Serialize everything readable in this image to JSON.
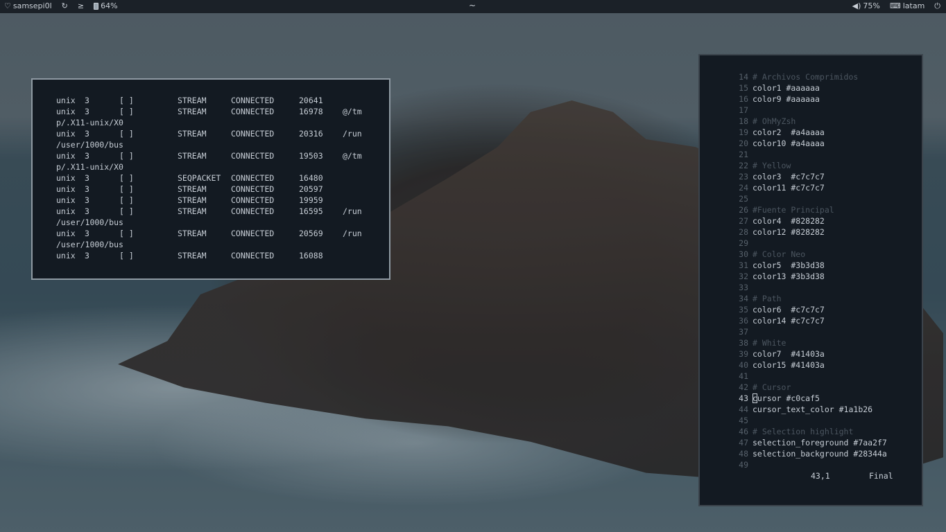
{
  "topbar": {
    "user": "samsepi0l",
    "battery": "64%",
    "center": "~",
    "volume": "75%",
    "keyboard": "latam",
    "icons": {
      "user": "heart-icon",
      "updates": "refresh-icon",
      "terminal": "terminal-prompt-icon",
      "battery": "battery-icon",
      "volume": "speaker-icon",
      "keyboard": "keyboard-icon",
      "power": "power-icon"
    }
  },
  "netstat": {
    "rows": [
      {
        "proto": "unix",
        "refcnt": "3",
        "flags": "[ ]",
        "type": "STREAM",
        "state": "CONNECTED",
        "inode": "20641",
        "path": ""
      },
      {
        "proto": "unix",
        "refcnt": "3",
        "flags": "[ ]",
        "type": "STREAM",
        "state": "CONNECTED",
        "inode": "16978",
        "path": "@/tm"
      },
      {
        "wrap": "p/.X11-unix/X0"
      },
      {
        "proto": "unix",
        "refcnt": "3",
        "flags": "[ ]",
        "type": "STREAM",
        "state": "CONNECTED",
        "inode": "20316",
        "path": "/run"
      },
      {
        "wrap": "/user/1000/bus"
      },
      {
        "proto": "unix",
        "refcnt": "3",
        "flags": "[ ]",
        "type": "STREAM",
        "state": "CONNECTED",
        "inode": "19503",
        "path": "@/tm"
      },
      {
        "wrap": "p/.X11-unix/X0"
      },
      {
        "proto": "unix",
        "refcnt": "3",
        "flags": "[ ]",
        "type": "SEQPACKET",
        "state": "CONNECTED",
        "inode": "16480",
        "path": ""
      },
      {
        "proto": "unix",
        "refcnt": "3",
        "flags": "[ ]",
        "type": "STREAM",
        "state": "CONNECTED",
        "inode": "20597",
        "path": ""
      },
      {
        "proto": "unix",
        "refcnt": "3",
        "flags": "[ ]",
        "type": "STREAM",
        "state": "CONNECTED",
        "inode": "19959",
        "path": ""
      },
      {
        "proto": "unix",
        "refcnt": "3",
        "flags": "[ ]",
        "type": "STREAM",
        "state": "CONNECTED",
        "inode": "16595",
        "path": "/run"
      },
      {
        "wrap": "/user/1000/bus"
      },
      {
        "proto": "unix",
        "refcnt": "3",
        "flags": "[ ]",
        "type": "STREAM",
        "state": "CONNECTED",
        "inode": "20569",
        "path": "/run"
      },
      {
        "wrap": "/user/1000/bus"
      },
      {
        "proto": "unix",
        "refcnt": "3",
        "flags": "[ ]",
        "type": "STREAM",
        "state": "CONNECTED",
        "inode": "16088",
        "path": ""
      }
    ]
  },
  "editor": {
    "lines": [
      {
        "n": "14",
        "text": "# Archivos Comprimidos",
        "comment": true
      },
      {
        "n": "15",
        "text": "color1 #aaaaaa"
      },
      {
        "n": "16",
        "text": "color9 #aaaaaa"
      },
      {
        "n": "17",
        "text": ""
      },
      {
        "n": "18",
        "text": "# OhMyZsh",
        "comment": true
      },
      {
        "n": "19",
        "text": "color2  #a4aaaa"
      },
      {
        "n": "20",
        "text": "color10 #a4aaaa"
      },
      {
        "n": "21",
        "text": ""
      },
      {
        "n": "22",
        "text": "# Yellow",
        "comment": true
      },
      {
        "n": "23",
        "text": "color3  #c7c7c7"
      },
      {
        "n": "24",
        "text": "color11 #c7c7c7"
      },
      {
        "n": "25",
        "text": ""
      },
      {
        "n": "26",
        "text": "#Fuente Principal",
        "comment": true
      },
      {
        "n": "27",
        "text": "color4  #828282"
      },
      {
        "n": "28",
        "text": "color12 #828282"
      },
      {
        "n": "29",
        "text": ""
      },
      {
        "n": "30",
        "text": "# Color Neo",
        "comment": true
      },
      {
        "n": "31",
        "text": "color5  #3b3d38"
      },
      {
        "n": "32",
        "text": "color13 #3b3d38"
      },
      {
        "n": "33",
        "text": ""
      },
      {
        "n": "34",
        "text": "# Path",
        "comment": true
      },
      {
        "n": "35",
        "text": "color6  #c7c7c7"
      },
      {
        "n": "36",
        "text": "color14 #c7c7c7"
      },
      {
        "n": "37",
        "text": ""
      },
      {
        "n": "38",
        "text": "# White",
        "comment": true
      },
      {
        "n": "39",
        "text": "color7  #41403a"
      },
      {
        "n": "40",
        "text": "color15 #41403a"
      },
      {
        "n": "41",
        "text": ""
      },
      {
        "n": "42",
        "text": "# Cursor",
        "comment": true
      },
      {
        "n": "43",
        "text": "cursor #c0caf5",
        "current": true
      },
      {
        "n": "44",
        "text": "cursor_text_color #1a1b26"
      },
      {
        "n": "45",
        "text": ""
      },
      {
        "n": "46",
        "text": "# Selection highlight",
        "comment": true
      },
      {
        "n": "47",
        "text": "selection_foreground #7aa2f7"
      },
      {
        "n": "48",
        "text": "selection_background #28344a"
      },
      {
        "n": "49",
        "text": ""
      }
    ],
    "status_position": "43,1",
    "status_mode": "Final"
  }
}
